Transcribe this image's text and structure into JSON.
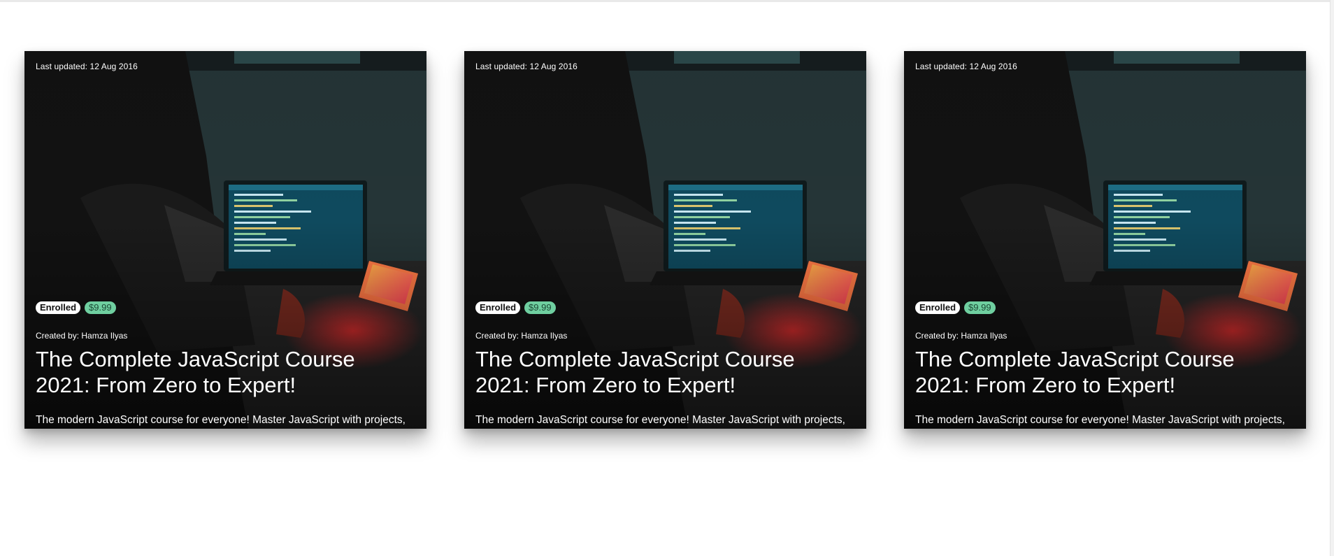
{
  "cards": [
    {
      "last_updated": "Last updated: 12 Aug 2016",
      "status_badge": "Enrolled",
      "price_badge": "$9.99",
      "creator": "Created by: Hamza Ilyas",
      "title": "The Complete JavaScript Course 2021: From Zero to Expert!",
      "description": "The modern JavaScript course for everyone! Master JavaScript with projects, challenges and theory. Many courses in one!",
      "image": "person-coding-at-laptop-photo"
    },
    {
      "last_updated": "Last updated: 12 Aug 2016",
      "status_badge": "Enrolled",
      "price_badge": "$9.99",
      "creator": "Created by: Hamza Ilyas",
      "title": "The Complete JavaScript Course 2021: From Zero to Expert!",
      "description": "The modern JavaScript course for everyone! Master JavaScript with projects, challenges and theory. Many courses in one!",
      "image": "person-coding-at-laptop-photo"
    },
    {
      "last_updated": "Last updated: 12 Aug 2016",
      "status_badge": "Enrolled",
      "price_badge": "$9.99",
      "creator": "Created by: Hamza Ilyas",
      "title": "The Complete JavaScript Course 2021: From Zero to Expert!",
      "description": "The modern JavaScript course for everyone! Master JavaScript with projects, challenges and theory. Many courses in one!",
      "image": "person-coding-at-laptop-photo"
    }
  ],
  "colors": {
    "card_background": "#1b2325",
    "price_badge": "#6fcfa0",
    "enrolled_badge": "#ffffff"
  }
}
